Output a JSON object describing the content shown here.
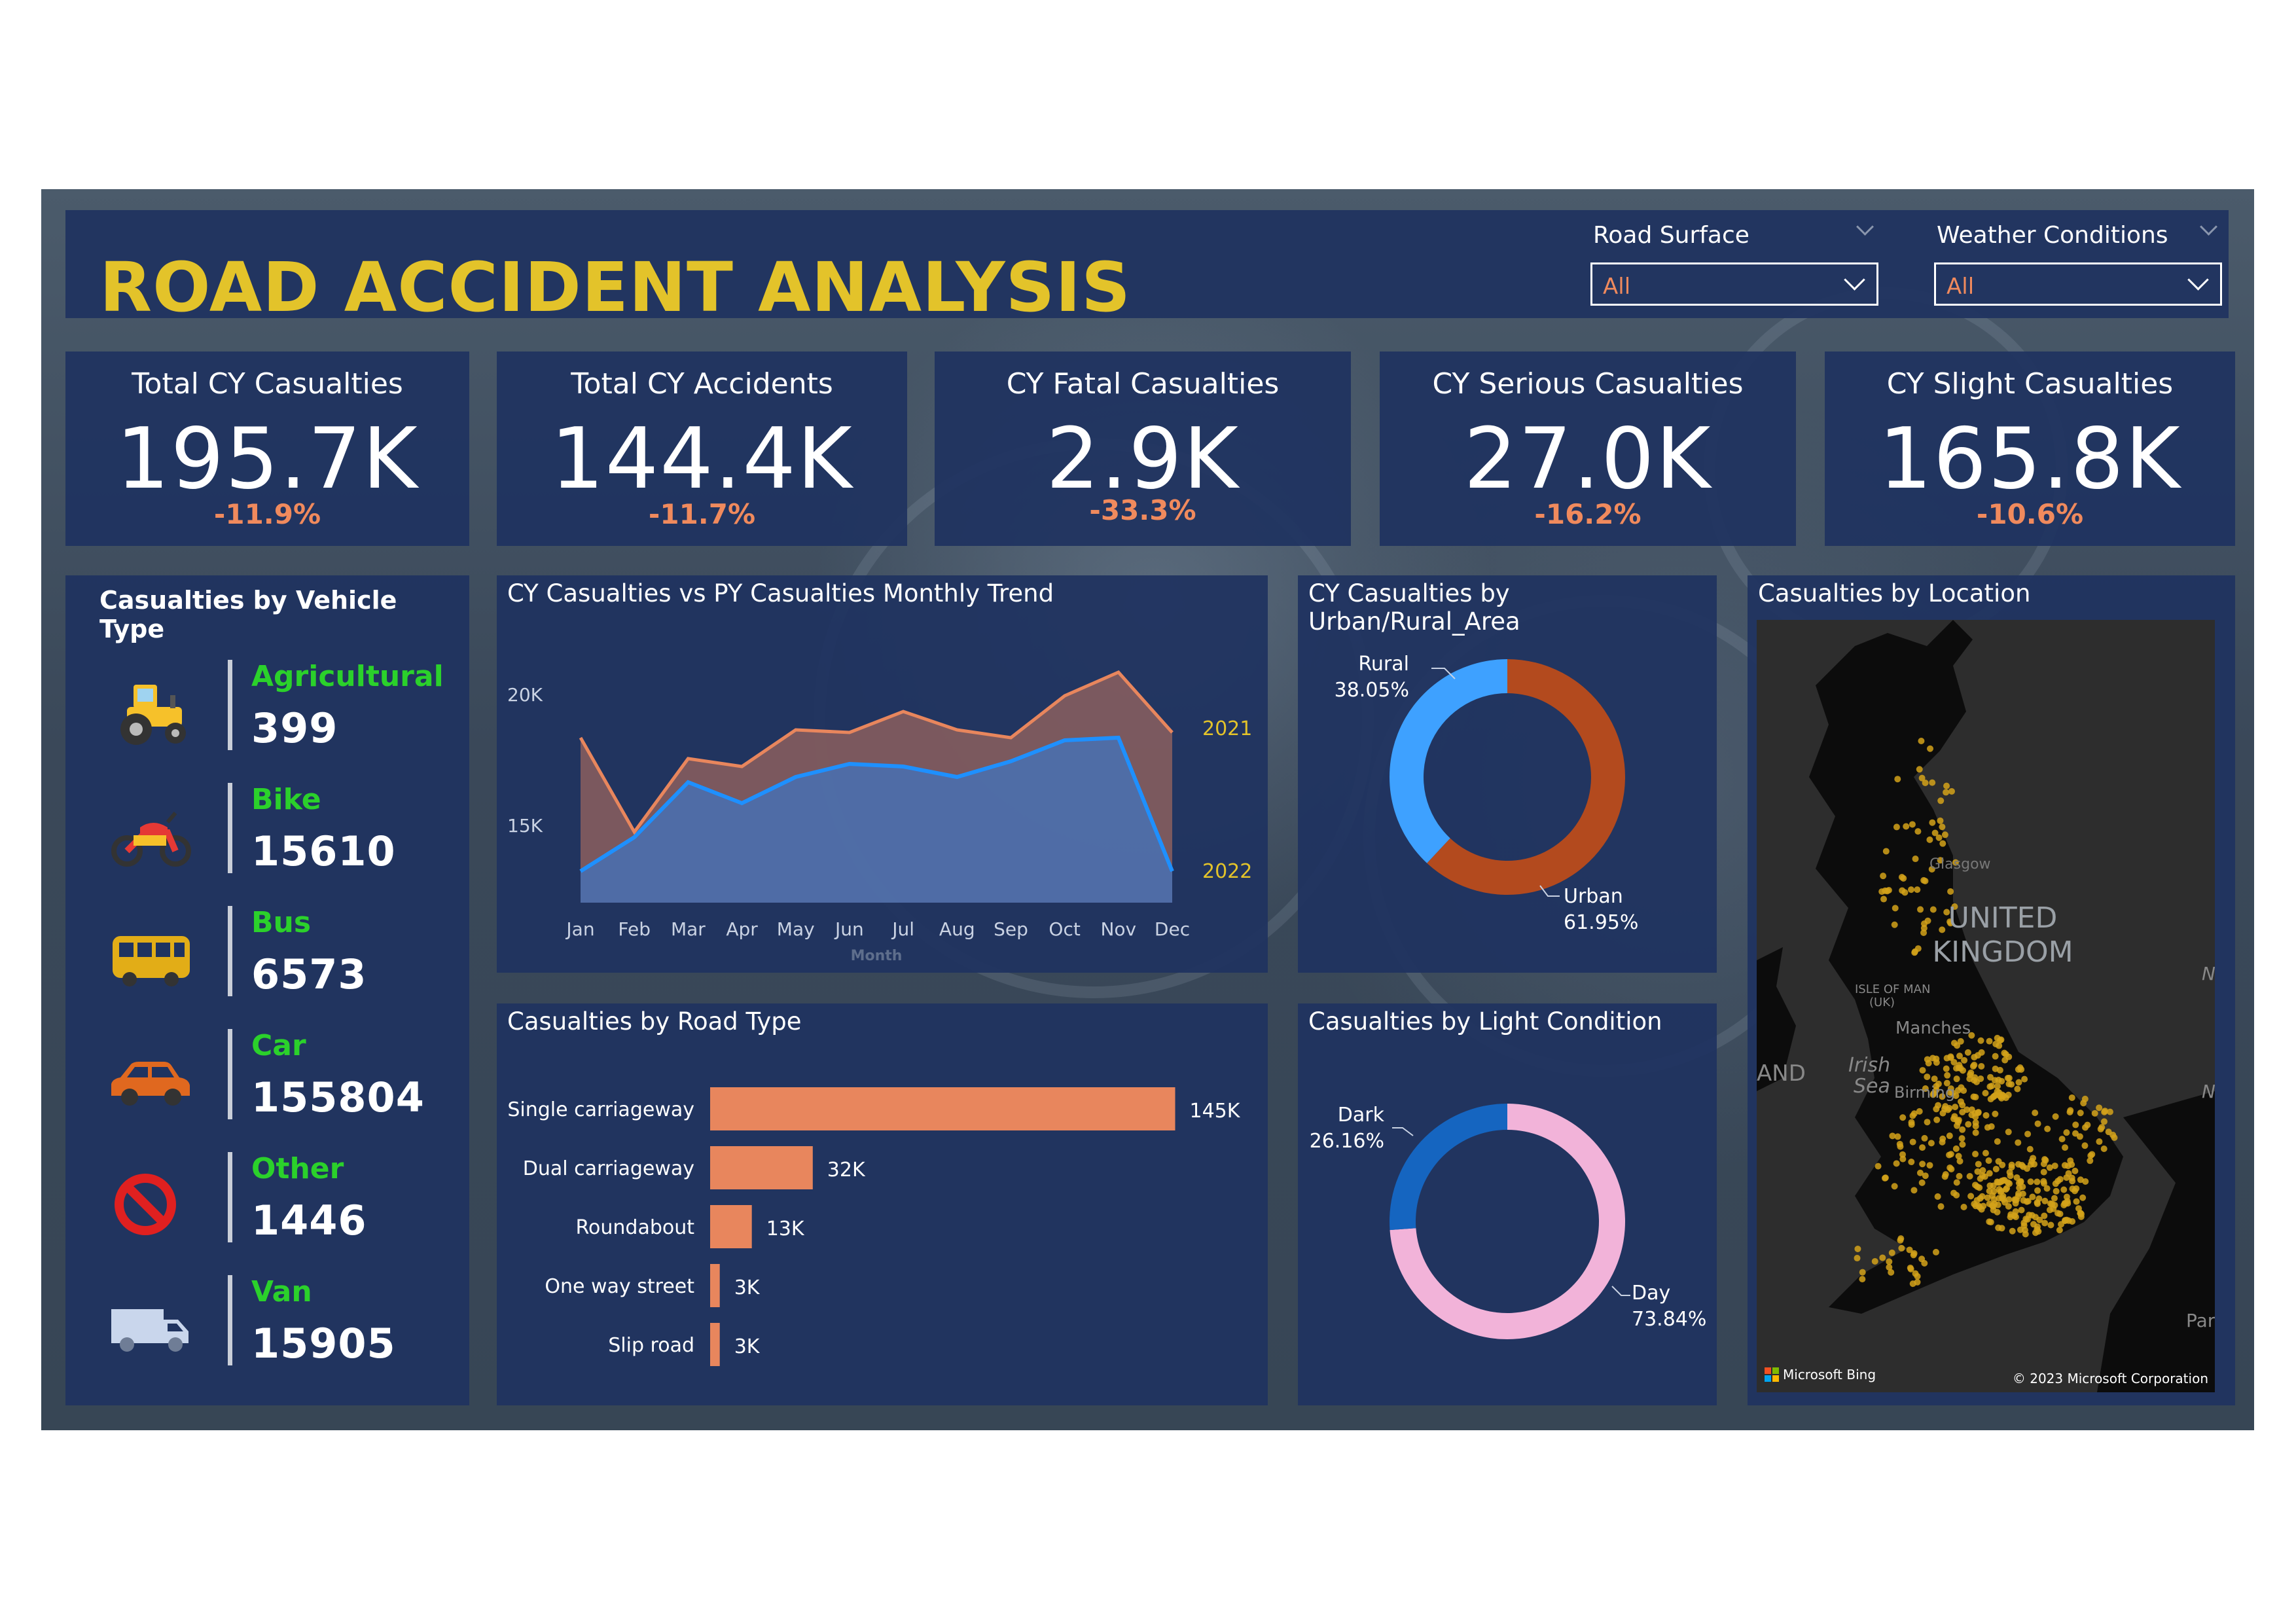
{
  "header": {
    "title": "ROAD ACCIDENT ANALYSIS",
    "slicers": [
      {
        "label": "Road Surface",
        "value": "All"
      },
      {
        "label": "Weather Conditions",
        "value": "All"
      }
    ]
  },
  "kpis": [
    {
      "title": "Total CY Casualties",
      "value": "195.7K",
      "delta": "-11.9%"
    },
    {
      "title": "Total CY Accidents",
      "value": "144.4K",
      "delta": "-11.7%"
    },
    {
      "title": "CY Fatal Casualties",
      "value": "2.9K",
      "delta": "-33.3%"
    },
    {
      "title": "CY Serious Casualties",
      "value": "27.0K",
      "delta": "-16.2%"
    },
    {
      "title": "CY Slight Casualties",
      "value": "165.8K",
      "delta": "-10.6%"
    }
  ],
  "vehicle_panel": {
    "title": "Casualties by Vehicle Type",
    "items": [
      {
        "name": "Agricultural",
        "value": "399",
        "icon": "tractor-icon"
      },
      {
        "name": "Bike",
        "value": "15610",
        "icon": "motorbike-icon"
      },
      {
        "name": "Bus",
        "value": "6573",
        "icon": "bus-icon"
      },
      {
        "name": "Car",
        "value": "155804",
        "icon": "car-icon"
      },
      {
        "name": "Other",
        "value": "1446",
        "icon": "no-entry-icon"
      },
      {
        "name": "Van",
        "value": "15905",
        "icon": "van-icon"
      }
    ]
  },
  "trend_panel": {
    "title": "CY Casualties vs PY Casualties Monthly Trend"
  },
  "urban_panel": {
    "title": "CY Casualties by Urban/Rural_Area"
  },
  "road_panel": {
    "title": "Casualties by Road Type"
  },
  "light_panel": {
    "title": "Casualties by Light Condition"
  },
  "map_panel": {
    "title": "Casualties by Location",
    "labels": [
      "UNITED",
      "KINGDOM",
      "Glasgow",
      "ISLE OF MAN",
      "(UK)",
      "Manches",
      "Irish",
      "Sea",
      "Birming",
      "AND",
      "N",
      "N",
      "Par"
    ],
    "bing_label": "Microsoft Bing",
    "copyright": "© 2023 Microsoft Corporation"
  },
  "colors": {
    "accent_title": "#e3c32a",
    "delta": "#f08a5d",
    "vehicle_name": "#2bd12b",
    "panel": "#1f3360",
    "py_area": "#e8865d",
    "cy_line": "#1e90ff",
    "urban": "#b34a1e",
    "rural": "#3ea1ff",
    "day": "#f2b3d9",
    "dark": "#1565c0"
  },
  "chart_data": [
    {
      "type": "area",
      "title": "CY Casualties vs PY Casualties Monthly Trend",
      "xlabel": "Month",
      "ylabel": "",
      "categories": [
        "Jan",
        "Feb",
        "Mar",
        "Apr",
        "May",
        "Jun",
        "Jul",
        "Aug",
        "Sep",
        "Oct",
        "Nov",
        "Dec"
      ],
      "y_ticks": [
        "20K",
        "15K"
      ],
      "ylim": [
        12000,
        22000
      ],
      "series": [
        {
          "name": "2021",
          "values": [
            18300,
            14700,
            17500,
            17200,
            18600,
            18500,
            19300,
            18600,
            18300,
            19900,
            20800,
            18500
          ]
        },
        {
          "name": "2022",
          "values": [
            13200,
            14500,
            16600,
            15800,
            16800,
            17300,
            17200,
            16800,
            17400,
            18200,
            18300,
            13200
          ]
        }
      ]
    },
    {
      "type": "pie",
      "title": "CY Casualties by Urban/Rural_Area",
      "labels": [
        "Urban",
        "Rural"
      ],
      "values": [
        61.95,
        38.05
      ],
      "value_labels": [
        "61.95%",
        "38.05%"
      ]
    },
    {
      "type": "bar",
      "title": "Casualties by Road Type",
      "categories": [
        "Single carriageway",
        "Dual carriageway",
        "Roundabout",
        "One way street",
        "Slip road"
      ],
      "values": [
        145,
        32,
        13,
        3,
        3
      ],
      "value_labels": [
        "145K",
        "32K",
        "13K",
        "3K",
        "3K"
      ],
      "xlim": [
        0,
        160
      ]
    },
    {
      "type": "pie",
      "title": "Casualties by Light Condition",
      "labels": [
        "Day",
        "Dark"
      ],
      "values": [
        73.84,
        26.16
      ],
      "value_labels": [
        "73.84%",
        "26.16%"
      ]
    }
  ]
}
